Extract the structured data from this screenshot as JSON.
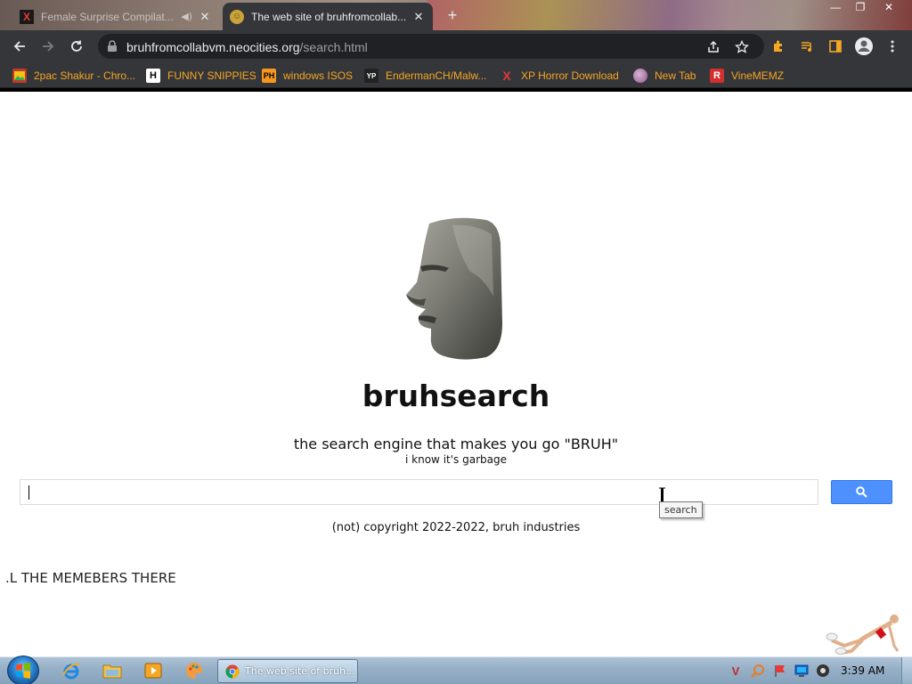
{
  "browser": {
    "tabs": [
      {
        "title": "Female Surprise Compilat...",
        "favicon": "X",
        "active": false
      },
      {
        "title": "The web site of bruhfromcollab...",
        "favicon": "☺",
        "active": true
      }
    ],
    "new_tab_label": "+",
    "window_controls": {
      "minimize": "—",
      "restore": "❐",
      "close": "✕"
    },
    "address": {
      "host": "bruhfromcollabvm.neocities.org",
      "path": "/search.html"
    }
  },
  "bookmarks": [
    {
      "label": "2pac Shakur - Chro...",
      "icon": "bookmark-icon-image",
      "icon_text": "",
      "icon_bg": "#c0392b"
    },
    {
      "label": "FUNNY SNIPPIES",
      "icon": "bookmark-icon-h",
      "icon_text": "H",
      "icon_bg": "#ffffff"
    },
    {
      "label": "windows ISOS",
      "icon": "bookmark-icon-ph",
      "icon_text": "PH",
      "icon_bg": "#f7971d"
    },
    {
      "label": "EndermanCH/Malw...",
      "icon": "bookmark-icon-yp",
      "icon_text": "YP",
      "icon_bg": "#222222"
    },
    {
      "label": "XP Horror Download",
      "icon": "bookmark-icon-x",
      "icon_text": "X",
      "icon_bg": "transparent"
    },
    {
      "label": "New Tab",
      "icon": "bookmark-icon-globe",
      "icon_text": "",
      "icon_bg": "#8e5a8a"
    },
    {
      "label": "VineMEMZ",
      "icon": "bookmark-icon-r",
      "icon_text": "R",
      "icon_bg": "#d32f2f"
    }
  ],
  "page": {
    "brand": "bruhsearch",
    "tagline": "the search engine that makes you go \"BRUH\"",
    "subtagline": "i know it's garbage",
    "search": {
      "value": "",
      "button_icon": "search-icon",
      "tooltip": "search"
    },
    "copyright": "(not) copyright 2022-2022, bruh industries",
    "marquee": ".L THE MEMEBERS THERE"
  },
  "taskbar": {
    "active_app_label": "The web site of bruh...",
    "clock": "3:39 AM"
  },
  "colors": {
    "chrome_dark": "#35363a",
    "omnibox": "#202124",
    "bookmark_text": "#f5a623",
    "search_button": "#4d90fe"
  }
}
